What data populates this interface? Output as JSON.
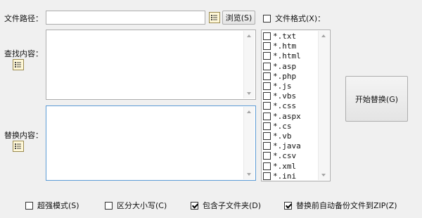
{
  "path": {
    "label": "文件路径：",
    "value": "",
    "browse_label": "浏览(S)"
  },
  "file_format": {
    "label": "文件格式(X)：",
    "checked": false
  },
  "search": {
    "label": "查找内容："
  },
  "replace": {
    "label": "替换内容："
  },
  "file_types": [
    {
      "label": "*.txt",
      "checked": false
    },
    {
      "label": "*.htm",
      "checked": false
    },
    {
      "label": "*.html",
      "checked": false
    },
    {
      "label": "*.asp",
      "checked": false
    },
    {
      "label": "*.php",
      "checked": false
    },
    {
      "label": "*.js",
      "checked": false
    },
    {
      "label": "*.vbs",
      "checked": false
    },
    {
      "label": "*.css",
      "checked": false
    },
    {
      "label": "*.aspx",
      "checked": false
    },
    {
      "label": "*.cs",
      "checked": false
    },
    {
      "label": "*.vb",
      "checked": false
    },
    {
      "label": "*.java",
      "checked": false
    },
    {
      "label": "*.csv",
      "checked": false
    },
    {
      "label": "*.xml",
      "checked": false
    },
    {
      "label": "*.ini",
      "checked": false
    }
  ],
  "start_button": {
    "label": "开始替换(G)"
  },
  "options": {
    "super_mode": {
      "label": "超强模式(S)",
      "checked": false
    },
    "case_sensitive": {
      "label": "区分大小写(C)",
      "checked": false
    },
    "include_subfolders": {
      "label": "包含子文件夹(D)",
      "checked": true
    },
    "backup_zip": {
      "label": "替换前自动备份文件到ZIP(Z)",
      "checked": true
    }
  }
}
